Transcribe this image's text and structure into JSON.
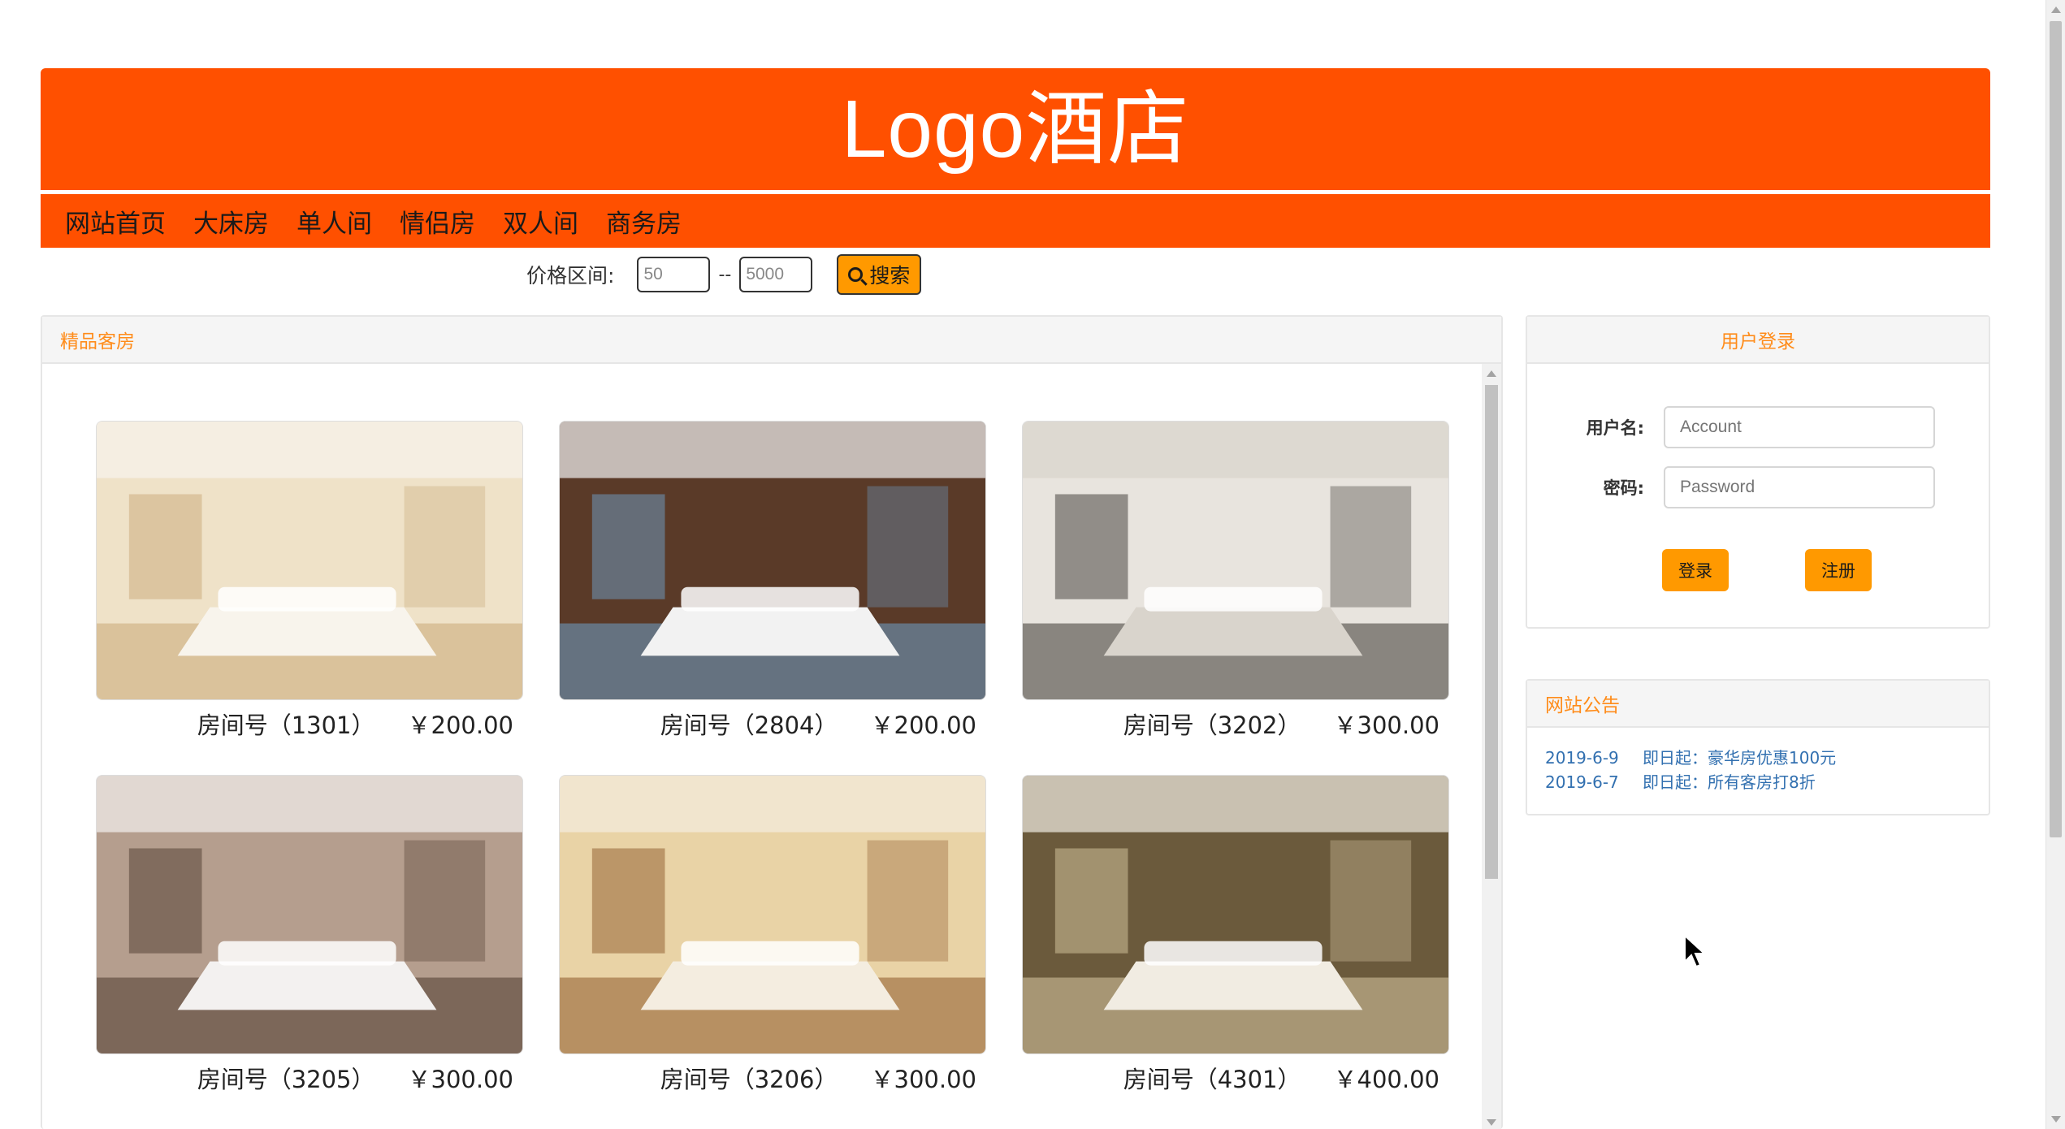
{
  "header": {
    "logo": "Logo酒店"
  },
  "nav": {
    "items": [
      "网站首页",
      "大床房",
      "单人间",
      "情侣房",
      "双人间",
      "商务房"
    ]
  },
  "price_filter": {
    "label": "价格区间:",
    "min_value": "50",
    "max_value": "5000",
    "separator": "--",
    "search_label": "搜索"
  },
  "rooms_panel": {
    "title": "精品客房",
    "rooms": [
      {
        "number": "房间号（1301）",
        "price": "￥200.00",
        "palette": [
          "#efe2c8",
          "#c9a877",
          "#f8f4ec"
        ]
      },
      {
        "number": "房间号（2804）",
        "price": "￥200.00",
        "palette": [
          "#5a3a28",
          "#6fa0c8",
          "#f2f2f2"
        ]
      },
      {
        "number": "房间号（3202）",
        "price": "￥300.00",
        "palette": [
          "#e8e4de",
          "#3a3632",
          "#d9d4cc"
        ]
      },
      {
        "number": "房间号（3205）",
        "price": "￥300.00",
        "palette": [
          "#b59e8e",
          "#4d3a2e",
          "#f3f1f0"
        ]
      },
      {
        "number": "房间号（3206）",
        "price": "￥300.00",
        "palette": [
          "#e9d3a6",
          "#8e5a2a",
          "#f4ede0"
        ]
      },
      {
        "number": "房间号（4301）",
        "price": "￥400.00",
        "palette": [
          "#6b5a3c",
          "#d9c9a2",
          "#f1ece2"
        ]
      }
    ]
  },
  "login": {
    "title": "用户登录",
    "username_label": "用户名:",
    "username_placeholder": "Account",
    "password_label": "密码:",
    "password_placeholder": "Password",
    "login_button": "登录",
    "register_button": "注册"
  },
  "notices": {
    "title": "网站公告",
    "items": [
      {
        "date": "2019-6-9",
        "text": "即日起：豪华房优惠100元"
      },
      {
        "date": "2019-6-7",
        "text": "即日起：所有客房打8折"
      }
    ]
  },
  "colors": {
    "brand": "#ff5000",
    "accent": "#ff9900",
    "heading": "#ff8c1a",
    "link": "#3270b0"
  }
}
